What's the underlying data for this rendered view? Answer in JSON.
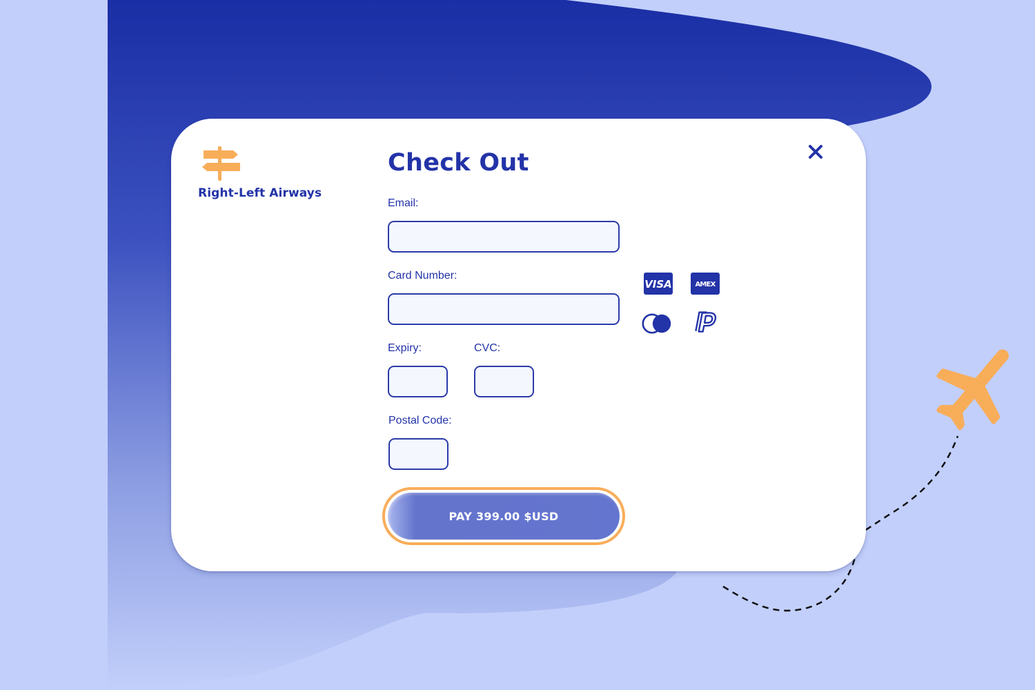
{
  "brand": {
    "name": "Right-Left Airways",
    "logo_icon": "signpost-icon",
    "accent_color": "#f8ad59"
  },
  "checkout": {
    "title": "Check Out",
    "close_icon": "close-icon"
  },
  "form": {
    "email": {
      "label": "Email:",
      "value": "",
      "placeholder": ""
    },
    "card_number": {
      "label": "Card Number:",
      "value": "",
      "placeholder": ""
    },
    "expiry": {
      "label": "Expiry:",
      "value": "",
      "placeholder": ""
    },
    "cvc": {
      "label": "CVC:",
      "value": "",
      "placeholder": ""
    },
    "postal_code": {
      "label": "Postal Code:",
      "value": "",
      "placeholder": ""
    }
  },
  "payment_methods": [
    {
      "name": "visa-icon",
      "text": "VISA"
    },
    {
      "name": "amex-icon",
      "text": "AMEX"
    },
    {
      "name": "mastercard-icon"
    },
    {
      "name": "paypal-icon"
    }
  ],
  "pay_button": {
    "label": "PAY 399.00 $USD"
  },
  "colors": {
    "primary": "#2333a8",
    "background": "#c2cffb",
    "accent": "#f8ad59",
    "button": "#6475cf"
  },
  "decorations": {
    "plane_icon": "airplane-icon",
    "flight_path": "dashed-flight-path"
  }
}
